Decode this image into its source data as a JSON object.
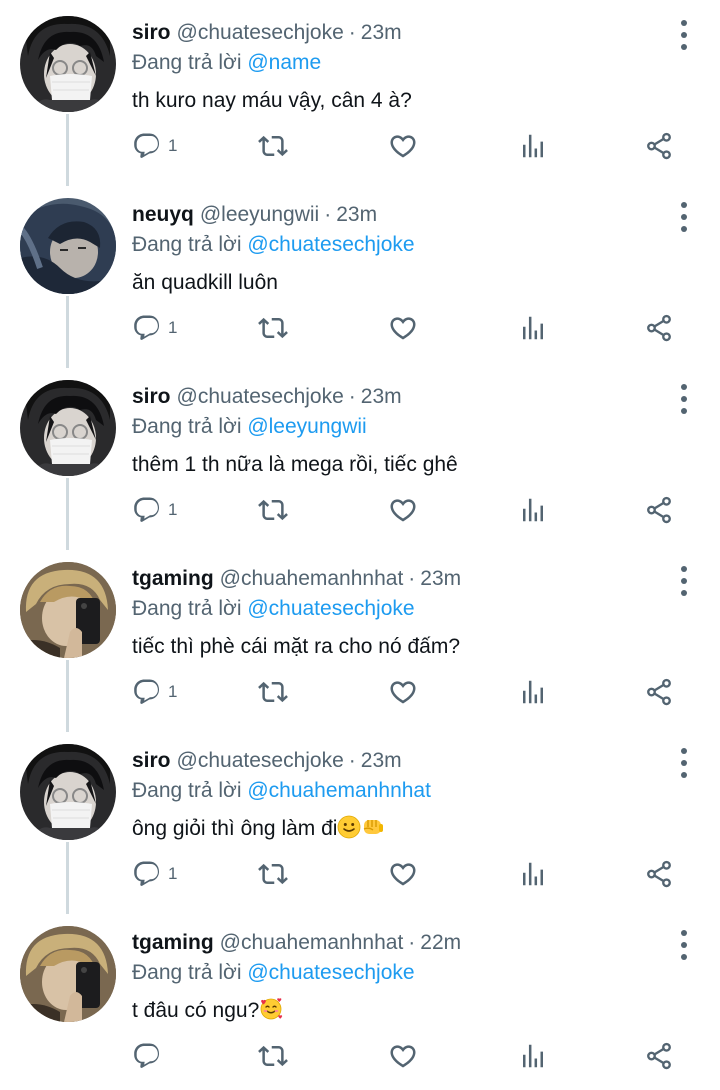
{
  "reply_prefix": "Đang trả lời",
  "tweets": [
    {
      "name": "siro",
      "handle": "@chuatesechjoke",
      "dot": "·",
      "time": "23m",
      "reply_to": "@name",
      "text": "th kuro nay máu vậy, cân 4 à?",
      "reply_count": "1",
      "avatar": "siro"
    },
    {
      "name": "neuyq",
      "handle": "@leeyungwii",
      "dot": "·",
      "time": "23m",
      "reply_to": "@chuatesechjoke",
      "text": "ăn quadkill luôn",
      "reply_count": "1",
      "avatar": "neuyq"
    },
    {
      "name": "siro",
      "handle": "@chuatesechjoke",
      "dot": "·",
      "time": "23m",
      "reply_to": "@leeyungwii",
      "text": "thêm 1 th nữa là mega rồi, tiếc ghê",
      "reply_count": "1",
      "avatar": "siro"
    },
    {
      "name": "tgaming",
      "handle": "@chuahemanhnhat",
      "dot": "·",
      "time": "23m",
      "reply_to": "@chuatesechjoke",
      "text": "tiếc thì phè cái mặt ra cho nó đấm?",
      "reply_count": "1",
      "avatar": "tgaming"
    },
    {
      "name": "siro",
      "handle": "@chuatesechjoke",
      "dot": "·",
      "time": "23m",
      "reply_to": "@chuahemanhnhat",
      "text": "ông giỏi thì ông làm đi",
      "emojis": [
        "slightly-smiling-face",
        "oncoming-fist"
      ],
      "reply_count": "1",
      "avatar": "siro"
    },
    {
      "name": "tgaming",
      "handle": "@chuahemanhnhat",
      "dot": "·",
      "time": "22m",
      "reply_to": "@chuatesechjoke",
      "text": "t đâu có ngu?",
      "emojis": [
        "smiling-face-with-hearts"
      ],
      "reply_count": "",
      "avatar": "tgaming"
    }
  ],
  "icons": {
    "reply": "reply-icon",
    "retweet": "retweet-icon",
    "like": "like-icon",
    "views": "views-icon",
    "share": "share-icon",
    "more": "more-icon"
  },
  "colors": {
    "mention": "#1d9bf0",
    "secondary_text": "#536471",
    "thread_line": "#cfd9de"
  }
}
